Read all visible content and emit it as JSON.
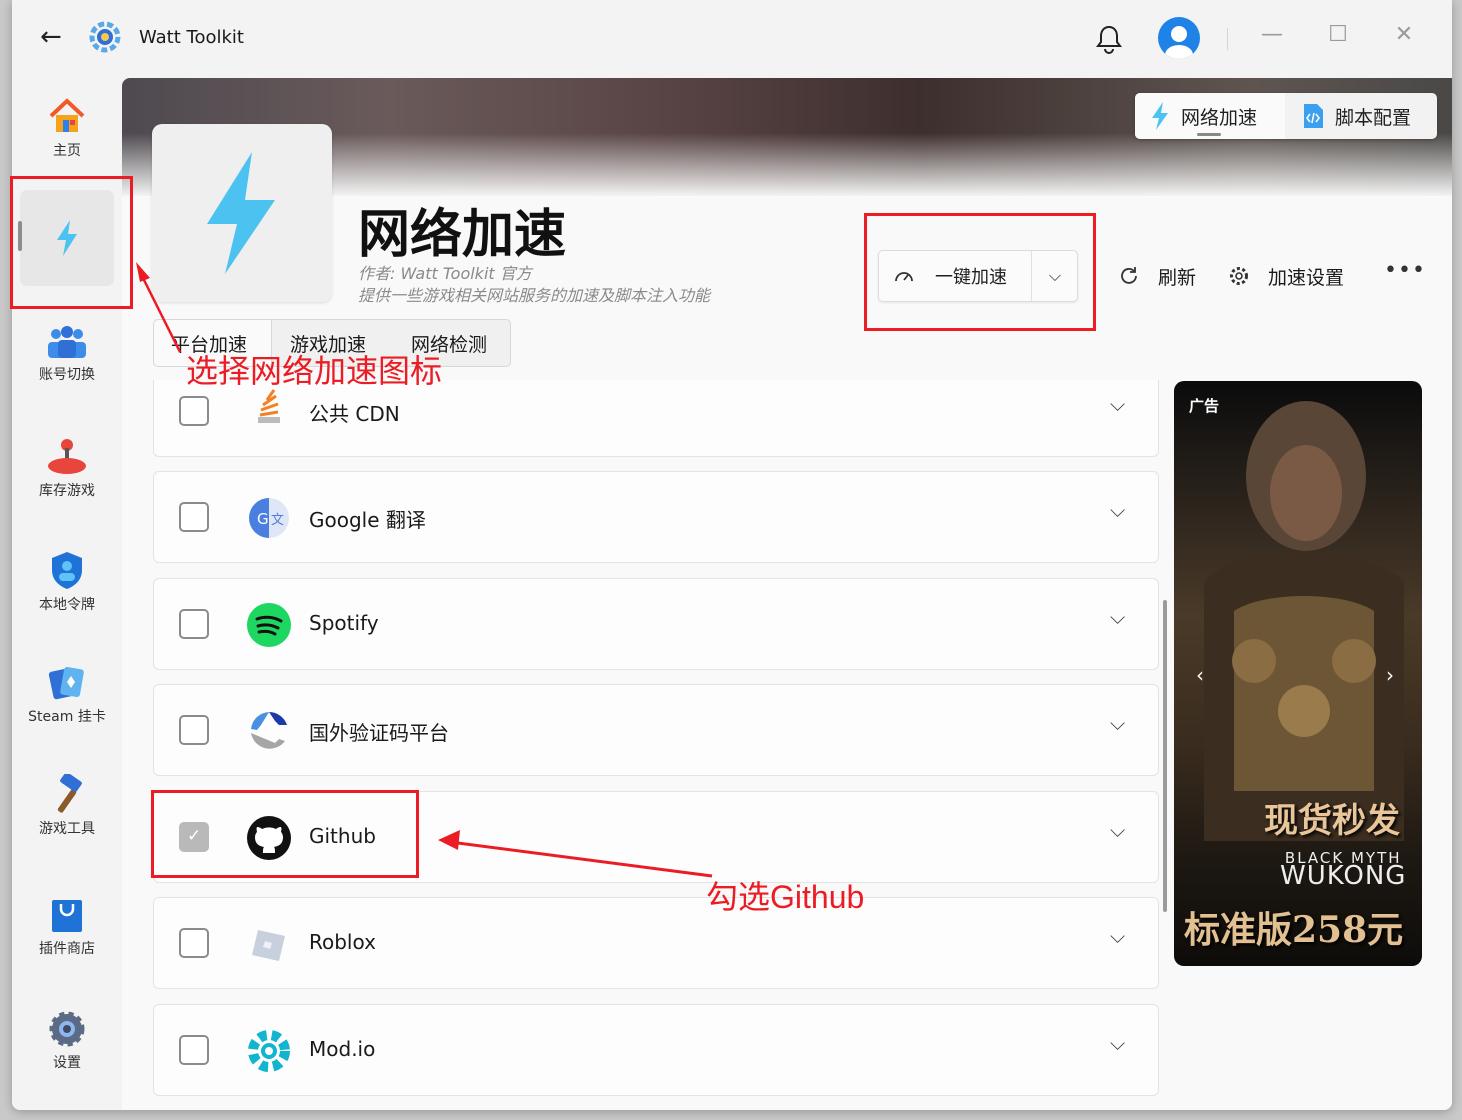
{
  "app": {
    "title": "Watt Toolkit"
  },
  "titlebar": {
    "minimize": "—",
    "maximize": "☐",
    "close": "✕"
  },
  "sidebar": {
    "items": [
      {
        "label": "主页"
      },
      {
        "label": ""
      },
      {
        "label": "账号切换"
      },
      {
        "label": "库存游戏"
      },
      {
        "label": "本地令牌"
      },
      {
        "label": "Steam 挂卡"
      },
      {
        "label": "游戏工具"
      },
      {
        "label": "插件商店"
      },
      {
        "label": "设置"
      }
    ]
  },
  "header_tabs": {
    "network": "网络加速",
    "script": "脚本配置"
  },
  "plugin": {
    "title": "网络加速",
    "author": "作者:  Watt Toolkit  官方",
    "description": "提供一些游戏相关网站服务的加速及脚本注入功能"
  },
  "actions": {
    "accelerate": "一键加速",
    "refresh": "刷新",
    "settings": "加速设置",
    "more": "•••"
  },
  "tabs": [
    "平台加速",
    "游戏加速",
    "网络检测"
  ],
  "list": [
    {
      "name": "公共 CDN",
      "checked": false
    },
    {
      "name": "Google 翻译",
      "checked": false
    },
    {
      "name": "Spotify",
      "checked": false
    },
    {
      "name": "国外验证码平台",
      "checked": false
    },
    {
      "name": "Github",
      "checked": true
    },
    {
      "name": "Roblox",
      "checked": false
    },
    {
      "name": "Mod.io",
      "checked": false
    }
  ],
  "ad": {
    "label": "广告",
    "promo_top": "现货秒发",
    "game_line1": "BLACK MYTH",
    "game_line2": "WUKONG",
    "promo_bottom": "标准版258元"
  },
  "annotations": {
    "select_icon": "选择网络加速图标",
    "check_github": "勾选Github"
  },
  "colors": {
    "accent": "#4cc2f1",
    "annotation": "#ec1c24",
    "spotify": "#1ed760"
  }
}
